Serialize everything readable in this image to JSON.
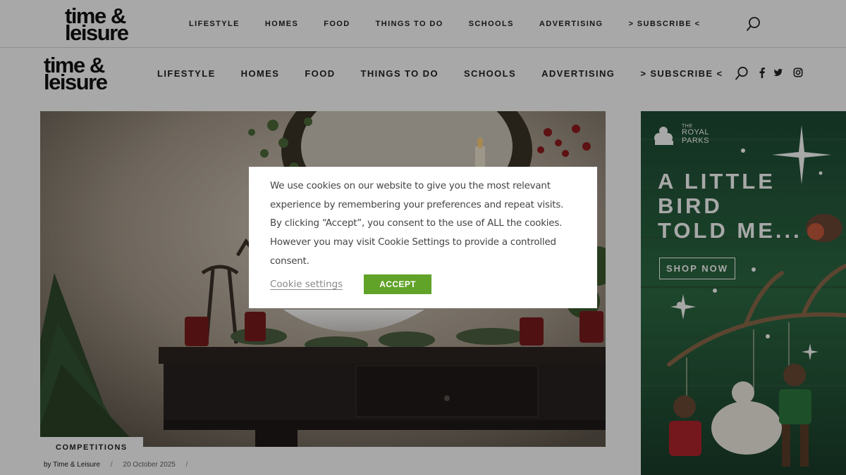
{
  "brand": {
    "line1": "time &",
    "line2": "leisure"
  },
  "top_nav": [
    "LIFESTYLE",
    "HOMES",
    "FOOD",
    "THINGS TO DO",
    "SCHOOLS",
    "ADVERTISING",
    "> SUBSCRIBE <"
  ],
  "main_nav": [
    "LIFESTYLE",
    "HOMES",
    "FOOD",
    "THINGS TO DO",
    "SCHOOLS",
    "ADVERTISING",
    "> SUBSCRIBE <"
  ],
  "icons": {
    "search": "search-icon",
    "facebook": "facebook-icon",
    "twitter": "twitter-icon",
    "instagram": "instagram-icon"
  },
  "article": {
    "category": "COMPETITIONS",
    "author": "by Time & Leisure",
    "separator": "/",
    "date": "20 October 2025"
  },
  "ad": {
    "org_small": "THE",
    "org_line1": "ROYAL",
    "org_line2": "PARKS",
    "headline": [
      "A LITTLE",
      "BIRD",
      "TOLD ME..."
    ],
    "cta": "SHOP NOW"
  },
  "cookie": {
    "message": "We use cookies on our website to give you the most relevant experience by remembering your preferences and repeat visits. By clicking “Accept”, you consent to the use of ALL the cookies. However you may visit Cookie Settings to provide a controlled consent.",
    "settings_label": "Cookie settings",
    "accept_label": "ACCEPT",
    "accent": "#61a229"
  }
}
